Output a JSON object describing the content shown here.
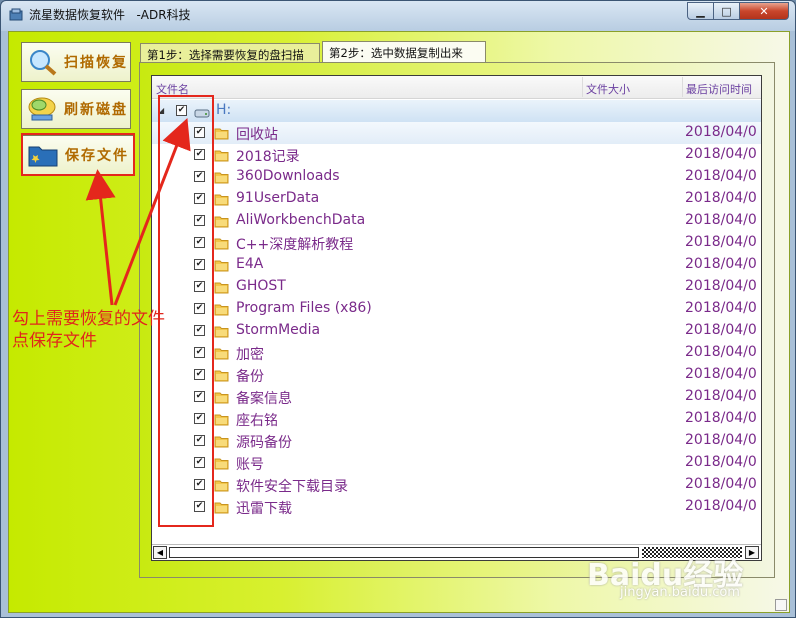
{
  "window": {
    "title": "流星数据恢复软件   -ADR科技"
  },
  "window_controls": {
    "minimize": "▁",
    "maximize": "□",
    "close": "✕"
  },
  "sidebar": {
    "scan_label": "扫描恢复",
    "refresh_label": "刷新磁盘",
    "save_label": "保存文件"
  },
  "tabs": [
    {
      "label": "第1步：选择需要恢复的盘扫描"
    },
    {
      "label": "第2步：选中数据复制出来"
    }
  ],
  "tree": {
    "columns": [
      "文件名",
      "文件大小",
      "最后访问时间"
    ],
    "root": {
      "label": "H:",
      "checked": true
    },
    "rows": [
      {
        "name": "回收站",
        "date": "2018/04/0"
      },
      {
        "name": "2018记录",
        "date": "2018/04/0"
      },
      {
        "name": "360Downloads",
        "date": "2018/04/0"
      },
      {
        "name": "91UserData",
        "date": "2018/04/0"
      },
      {
        "name": "AliWorkbenchData",
        "date": "2018/04/0"
      },
      {
        "name": "C++深度解析教程",
        "date": "2018/04/0"
      },
      {
        "name": "E4A",
        "date": "2018/04/0"
      },
      {
        "name": "GHOST",
        "date": "2018/04/0"
      },
      {
        "name": "Program Files (x86)",
        "date": "2018/04/0"
      },
      {
        "name": "StormMedia",
        "date": "2018/04/0"
      },
      {
        "name": "加密",
        "date": "2018/04/0"
      },
      {
        "name": "备份",
        "date": "2018/04/0"
      },
      {
        "name": "备案信息",
        "date": "2018/04/0"
      },
      {
        "name": "座右铭",
        "date": "2018/04/0"
      },
      {
        "name": "源码备份",
        "date": "2018/04/0"
      },
      {
        "name": "账号",
        "date": "2018/04/0"
      },
      {
        "name": "软件安全下载目录",
        "date": "2018/04/0"
      },
      {
        "name": "迅雷下载",
        "date": "2018/04/0"
      }
    ]
  },
  "annotation": {
    "line1": "勾上需要恢复的文件",
    "line2": "点保存文件"
  },
  "watermark": {
    "logo": "Baidu经验",
    "url": "jingyan.baidu.com"
  }
}
